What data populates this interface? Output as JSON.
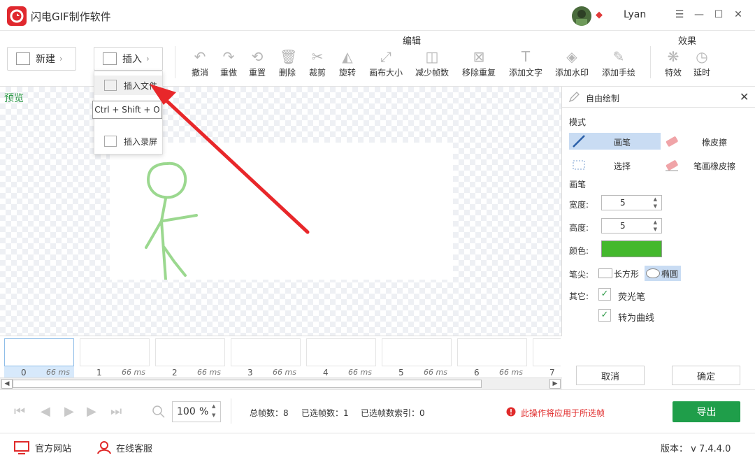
{
  "app": {
    "title": "闪电GIF制作软件",
    "user": "Lyan"
  },
  "toolbar": {
    "new_label": "新建",
    "insert_label": "插入",
    "edit_group": "编辑",
    "effect_group": "效果",
    "tools": [
      "撤消",
      "重做",
      "重置",
      "删除",
      "裁剪",
      "旋转",
      "画布大小",
      "减少帧数",
      "移除重复",
      "添加文字",
      "添加水印",
      "添加手绘"
    ],
    "effects": [
      "特效",
      "延时"
    ]
  },
  "insert_menu": {
    "insert_file": "插入文件",
    "shortcut": "Ctrl + Shift + O",
    "insert_record": "插入录屏"
  },
  "preview": {
    "label": "预览"
  },
  "frames": [
    {
      "index": "0",
      "delay": "66 ms"
    },
    {
      "index": "1",
      "delay": "66 ms"
    },
    {
      "index": "2",
      "delay": "66 ms"
    },
    {
      "index": "3",
      "delay": "66 ms"
    },
    {
      "index": "4",
      "delay": "66 ms"
    },
    {
      "index": "5",
      "delay": "66 ms"
    },
    {
      "index": "6",
      "delay": "66 ms"
    },
    {
      "index": "7",
      "delay": ""
    }
  ],
  "panel": {
    "title": "自由绘制",
    "mode_section": "模式",
    "modes": {
      "pen": "画笔",
      "eraser": "橡皮擦",
      "select": "选择",
      "stroke_eraser": "笔画橡皮擦"
    },
    "pen_section": "画笔",
    "width_label": "宽度:",
    "width_value": "5",
    "height_label": "高度:",
    "height_value": "5",
    "color_label": "颜色:",
    "color": "#44b82d",
    "tip_label": "笔尖:",
    "tip_rect": "长方形",
    "tip_ellipse": "椭圆",
    "other_label": "其它:",
    "highlighter": "荧光笔",
    "to_curve": "转为曲线",
    "cancel": "取消",
    "confirm": "确定"
  },
  "playback": {
    "zoom_value": "100",
    "zoom_unit": "%",
    "total_frames": "总帧数：8",
    "selected_frames": "已选帧数：1",
    "selected_index": "已选帧数索引：0",
    "warning": "此操作将应用于所选帧",
    "export": "导出"
  },
  "footer": {
    "website": "官方网站",
    "support": "在线客服",
    "version": "版本： v 7.4.4.0"
  }
}
